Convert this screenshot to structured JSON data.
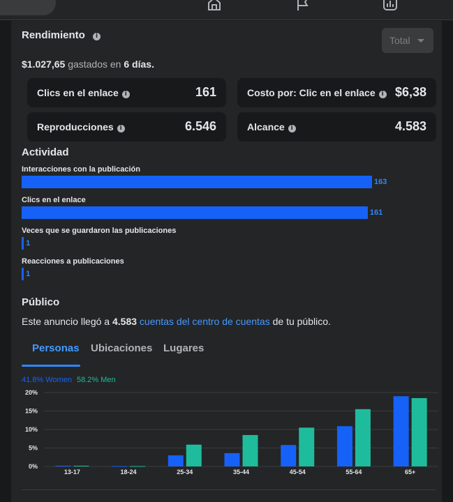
{
  "topbar": {
    "icons": [
      "home-icon",
      "flag-icon",
      "insights-icon"
    ]
  },
  "performance": {
    "title": "Rendimiento",
    "dropdown_value": "Total",
    "spent_amount": "$1.027,65",
    "spent_text": "gastados en",
    "spent_days": "6 días.",
    "metrics": [
      {
        "label": "Clics en el enlace",
        "value": "161"
      },
      {
        "label": "Costo por: Clic en el enlace",
        "value": "$6,38"
      },
      {
        "label": "Reproducciones",
        "value": "6.546"
      },
      {
        "label": "Alcance",
        "value": "4.583"
      }
    ]
  },
  "activity": {
    "title": "Actividad",
    "items": [
      {
        "label": "Interacciones con la publicación",
        "value": 163
      },
      {
        "label": "Clics en el enlace",
        "value": 161
      },
      {
        "label": "Veces que se guardaron las publicaciones",
        "value": 1
      },
      {
        "label": "Reacciones a publicaciones",
        "value": 1
      }
    ]
  },
  "audience": {
    "title": "Público",
    "reach_prefix": "Este anuncio llegó a",
    "reach_value": "4.583",
    "reach_link": "cuentas del centro de cuentas",
    "reach_suffix": "de tu público.",
    "tabs": [
      "Personas",
      "Ubicaciones",
      "Lugares"
    ],
    "active_tab": "Personas"
  },
  "colors": {
    "women": "#1662f8",
    "men": "#1ebc9c",
    "accent": "#2d88ff"
  },
  "chart_data": {
    "type": "bar",
    "legend_items": [
      "41.8% Women",
      "58.2% Men"
    ],
    "categories": [
      "13-17",
      "18-24",
      "25-34",
      "35-44",
      "45-54",
      "55-64",
      "65+"
    ],
    "series": [
      {
        "values": [
          0.2,
          0.1,
          3.0,
          3.6,
          5.8,
          10.9,
          19.0
        ]
      },
      {
        "values": [
          0.2,
          0.1,
          5.9,
          8.5,
          10.5,
          15.5,
          18.5
        ]
      }
    ],
    "yticks": [
      "0%",
      "5%",
      "10%",
      "15%",
      "20%"
    ],
    "ylim": [
      0,
      20
    ],
    "grid": true
  }
}
